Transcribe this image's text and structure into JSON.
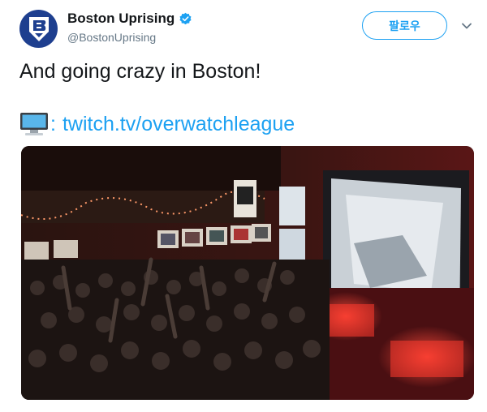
{
  "author": {
    "display_name": "Boston Uprising",
    "handle": "@BostonUprising",
    "avatar_icon": "boston-uprising-logo",
    "verified_icon": "verified-badge-icon"
  },
  "follow_button": {
    "label": "팔로우"
  },
  "menu_icon": "chevron-down-icon",
  "tweet": {
    "text": "And going crazy in Boston!",
    "link_prefix_icon": "computer-emoji",
    "link_colon": ":",
    "link_text": "twitch.tv/overwatchleague"
  },
  "media": {
    "kind": "photo",
    "description_icon": "bar-crowd-photo"
  },
  "colors": {
    "accent": "#1da1f2",
    "avatar_bg": "#1e3f8f",
    "text": "#14171a",
    "muted": "#657786"
  }
}
